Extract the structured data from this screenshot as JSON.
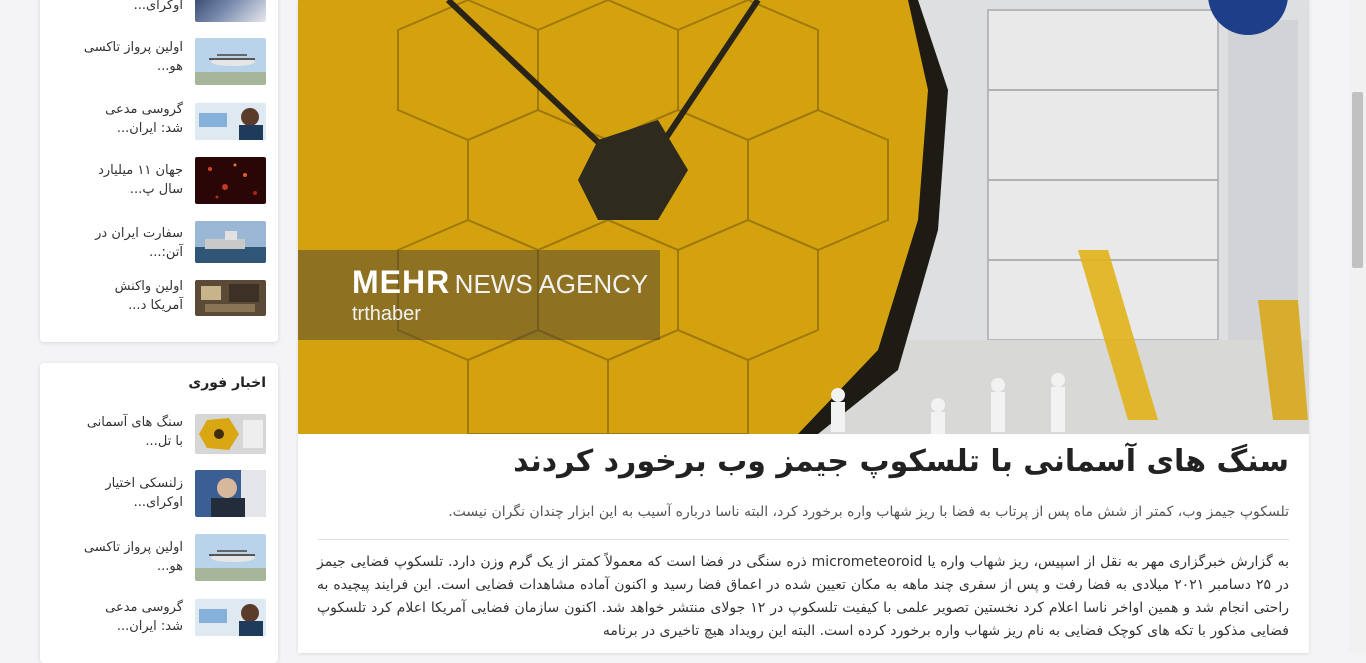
{
  "sidebar": {
    "top_card": {
      "items": [
        {
          "text": "اوکرای..."
        },
        {
          "text": "اولین پرواز تاکسی هو..."
        },
        {
          "text": "گروسی مدعی شد: ایران..."
        },
        {
          "text": "جهان ۱۱ میلیارد سال پ..."
        },
        {
          "text": "سفارت ایران در آتن:..."
        },
        {
          "text": "اولین واکنش آمریکا د..."
        }
      ]
    },
    "breaking_news": {
      "title": "اخبار فوری",
      "items": [
        {
          "text": "سنگ های آسمانی با تل..."
        },
        {
          "text": "زلنسکی اختیار اوکرای..."
        },
        {
          "text": "اولین پرواز تاکسی هو..."
        },
        {
          "text": "گروسی مدعی شد: ایران..."
        }
      ]
    }
  },
  "article": {
    "image": {
      "watermark_brand": "MEHR",
      "watermark_agency": "NEWS AGENCY",
      "watermark_source": "trthaber"
    },
    "headline": "سنگ های آسمانی با تلسکوپ جیمز وب برخورد کردند",
    "lead": "تلسکوپ جیمز وب، کمتر از شش ماه پس از پرتاب به فضا با ریز شهاب واره برخورد کرد، البته ناسا درباره آسیب به این ابزار چندان نگران نیست.",
    "body": "به گزارش خبرگزاری مهر به نقل از اسپیس، ریز شهاب واره یا micrometeoroid ذره سنگی در فضا است که معمولاً کمتر از یک گرم وزن دارد. تلسکوپ فضایی جیمز در ۲۵ دسامبر ۲۰۲۱ میلادی به فضا رفت و پس از سفری چند ماهه به مکان تعیین شده در اعماق فضا رسید و اکنون آماده مشاهدات فضایی است. این فرایند پیچیده به راحتی انجام شد و همین اواخر ناسا اعلام کرد نخستین تصویر علمی با کیفیت تلسکوپ در ۱۲ جولای منتشر خواهد شد. اکنون سازمان فضایی آمریکا اعلام کرد تلسکوپ فضایی مذکور با تکه های کوچک فضایی به نام ریز شهاب واره برخورد کرده است. البته این رویداد هیچ تاخیری در برنامه"
  }
}
